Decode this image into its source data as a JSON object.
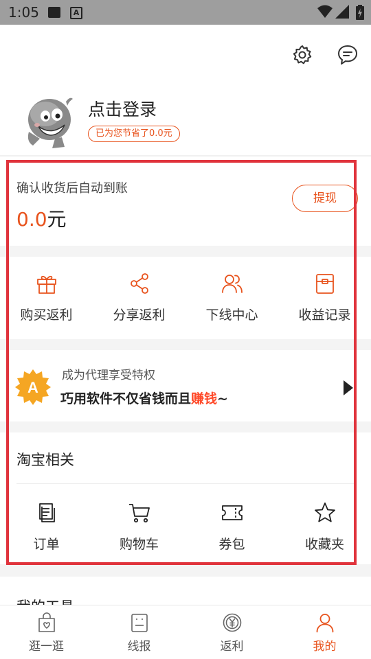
{
  "status_bar": {
    "time": "1:05"
  },
  "profile": {
    "login_text": "点击登录",
    "saving_text": "已为您节省了0.0元"
  },
  "balance": {
    "label": "确认收货后自动到账",
    "amount": "0.0",
    "unit": "元",
    "withdraw_label": "提现"
  },
  "rebate_actions": [
    {
      "label": "购买返利",
      "icon": "gift-icon"
    },
    {
      "label": "分享返利",
      "icon": "share-icon"
    },
    {
      "label": "下线中心",
      "icon": "users-icon"
    },
    {
      "label": "收益记录",
      "icon": "wallet-icon"
    }
  ],
  "agent": {
    "badge_letter": "A",
    "subtitle": "成为代理享受特权",
    "headline_prefix": "巧用软件不仅省钱而且",
    "headline_accent": "赚钱",
    "headline_suffix": "~"
  },
  "taobao": {
    "title": "淘宝相关",
    "items": [
      {
        "label": "订单",
        "icon": "order-icon"
      },
      {
        "label": "购物车",
        "icon": "cart-icon"
      },
      {
        "label": "券包",
        "icon": "coupon-icon"
      },
      {
        "label": "收藏夹",
        "icon": "star-icon"
      }
    ]
  },
  "tools": {
    "title": "我的工具"
  },
  "tabbar": [
    {
      "label": "逛一逛",
      "icon": "shopping-bag-icon",
      "active": false
    },
    {
      "label": "线报",
      "icon": "news-icon",
      "active": false
    },
    {
      "label": "返利",
      "icon": "yen-coin-icon",
      "active": false
    },
    {
      "label": "我的",
      "icon": "person-icon",
      "active": true
    }
  ],
  "colors": {
    "accent": "#e8531d",
    "highlight_frame": "#e0333c",
    "agent_badge": "#f5a623"
  }
}
